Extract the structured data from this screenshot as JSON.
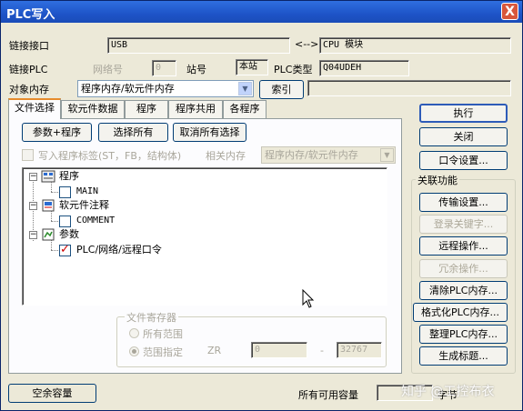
{
  "window": {
    "title": "PLC写入",
    "close": "X"
  },
  "connection": {
    "link_label": "链接接口",
    "link_value": "USB",
    "arrow": "<-->",
    "cpu_value": "CPU 模块",
    "plc_label": "链接PLC",
    "network_label": "网络号",
    "network_value": "0",
    "station_label": "站号",
    "station_value": "本站",
    "type_label": "PLC类型",
    "type_value": "Q04UDEH"
  },
  "target": {
    "label": "对象内存",
    "value": "程序内存/软元件内存",
    "index_button": "索引"
  },
  "tabs": [
    "文件选择",
    "软元件数据",
    "程序",
    "程序共用",
    "各程序"
  ],
  "panel": {
    "btn_param_prog": "参数+程序",
    "btn_select_all": "选择所有",
    "btn_deselect_all": "取消所有选择",
    "write_label_check": "写入程序标签(ST，FB，结构体)",
    "related_memory_label": "相关内存",
    "related_memory_value": "程序内存/软元件内存",
    "tree": {
      "program": "程序",
      "main": "MAIN",
      "comment_group": "软元件注释",
      "comment": "COMMENT",
      "param_group": "参数",
      "param_item": "PLC/网络/远程口令"
    },
    "file_register": {
      "title": "文件寄存器",
      "all_range": "所有范围",
      "range_spec": "范围指定",
      "zr": "ZR",
      "from": "0",
      "dash": "-",
      "to": "32767"
    }
  },
  "right": {
    "execute": "执行",
    "close": "关闭",
    "password_settings": "口令设置...",
    "group_title": "关联功能",
    "transfer_settings": "传输设置...",
    "login_keyword": "登录关键字...",
    "remote_operation": "远程操作...",
    "redundant_operation": "冗余操作...",
    "clear_plc_memory": "清除PLC内存...",
    "format_plc_memory": "格式化PLC内存...",
    "arrange_plc_memory": "整理PLC内存...",
    "generate_title": "生成标题..."
  },
  "status": {
    "free_capacity": "空余容量",
    "all_capacity": "所有可用容量",
    "bytes": "字节",
    "watermark": "知乎 @工控布衣"
  }
}
